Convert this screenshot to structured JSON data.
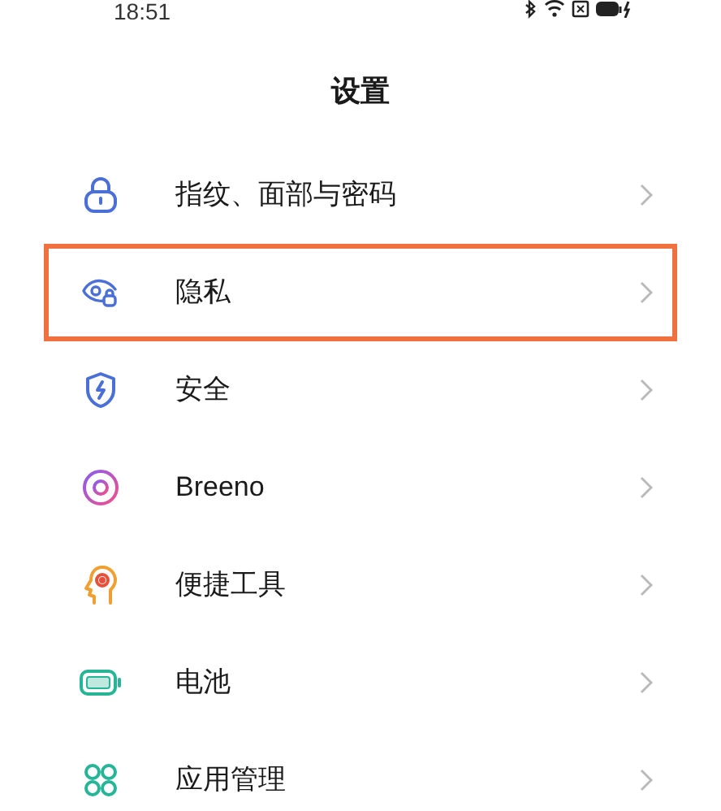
{
  "status_bar": {
    "time": "18:51"
  },
  "title": "设置",
  "items": [
    {
      "label": "指纹、面部与密码",
      "highlighted": false
    },
    {
      "label": "隐私",
      "highlighted": true
    },
    {
      "label": "安全",
      "highlighted": false
    },
    {
      "label": "Breeno",
      "highlighted": false
    },
    {
      "label": "便捷工具",
      "highlighted": false
    },
    {
      "label": "电池",
      "highlighted": false
    },
    {
      "label": "应用管理",
      "highlighted": false
    }
  ]
}
